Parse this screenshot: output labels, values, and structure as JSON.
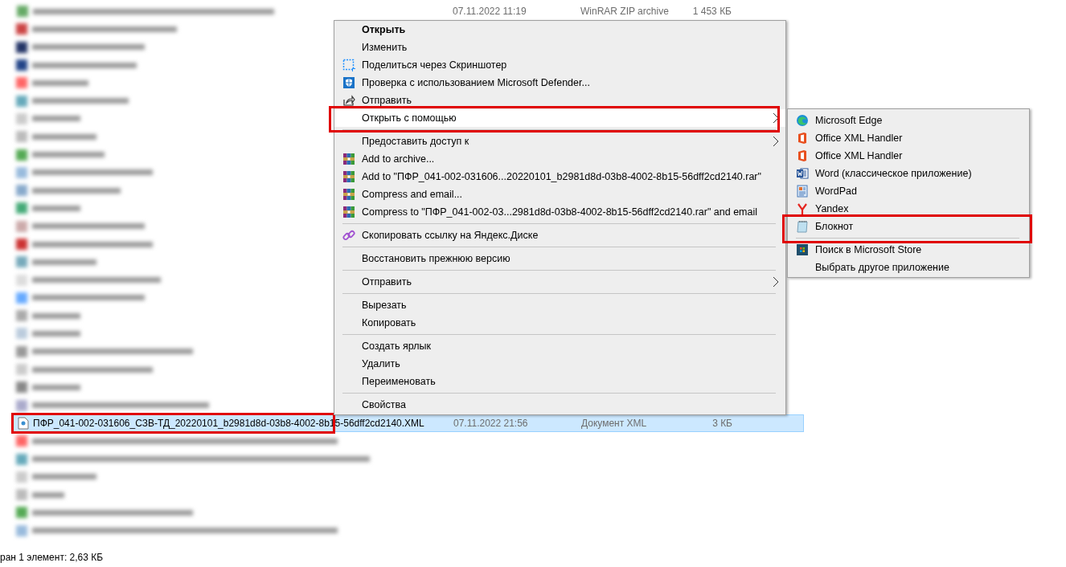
{
  "files_top": [
    {
      "date": "07.11.2022 11:19",
      "type": "WinRAR ZIP archive",
      "size": "1 453 КБ"
    }
  ],
  "selected_file": {
    "name": "ПФР_041-002-031606_СЗВ-ТД_20220101_b2981d8d-03b8-4002-8b15-56dff2cd2140.XML",
    "date": "07.11.2022 21:56",
    "type": "Документ XML",
    "size": "3 КБ",
    "selected": true,
    "highlighted": true
  },
  "context_menu": [
    {
      "kind": "item",
      "label": "Открыть",
      "default": true
    },
    {
      "kind": "item",
      "label": "Изменить"
    },
    {
      "kind": "item",
      "label": "Поделиться через Скриншотер"
    },
    {
      "kind": "item",
      "label": "Проверка с использованием Microsoft Defender..."
    },
    {
      "kind": "item",
      "label": "Отправить"
    },
    {
      "kind": "item",
      "label": "Открыть с помощью",
      "submenu": true,
      "selected": true,
      "highlighted": true
    },
    {
      "kind": "separator"
    },
    {
      "kind": "item",
      "label": "Предоставить доступ к",
      "submenu": true,
      "selected": false
    },
    {
      "kind": "item",
      "label": "Add to archive..."
    },
    {
      "kind": "item",
      "label": "Add to \"ПФР_041-002-031606...20220101_b2981d8d-03b8-4002-8b15-56dff2cd2140.rar\""
    },
    {
      "kind": "item",
      "label": "Compress and email..."
    },
    {
      "kind": "item",
      "label": "Compress to \"ПФР_041-002-03...2981d8d-03b8-4002-8b15-56dff2cd2140.rar\" and email"
    },
    {
      "kind": "separator"
    },
    {
      "kind": "item",
      "label": "Скопировать ссылку на Яндекс.Диске"
    },
    {
      "kind": "separator"
    },
    {
      "kind": "item",
      "label": "Восстановить прежнюю версию"
    },
    {
      "kind": "separator"
    },
    {
      "kind": "item",
      "label": "Отправить",
      "submenu": true,
      "selected": false
    },
    {
      "kind": "separator"
    },
    {
      "kind": "item",
      "label": "Вырезать"
    },
    {
      "kind": "item",
      "label": "Копировать"
    },
    {
      "kind": "separator"
    },
    {
      "kind": "item",
      "label": "Создать ярлык"
    },
    {
      "kind": "item",
      "label": "Удалить"
    },
    {
      "kind": "item",
      "label": "Переименовать"
    },
    {
      "kind": "separator"
    },
    {
      "kind": "item",
      "label": "Свойства"
    }
  ],
  "open_with_submenu": [
    {
      "kind": "item",
      "label": "Microsoft Edge"
    },
    {
      "kind": "item",
      "label": "Office XML Handler"
    },
    {
      "kind": "item",
      "label": "Office XML Handler"
    },
    {
      "kind": "item",
      "label": "Word (классическое приложение)"
    },
    {
      "kind": "item",
      "label": "WordPad"
    },
    {
      "kind": "item",
      "label": "Yandex"
    },
    {
      "kind": "item",
      "label": "Блокнот",
      "highlighted": true
    },
    {
      "kind": "separator"
    },
    {
      "kind": "item",
      "label": "Поиск в Microsoft Store"
    },
    {
      "kind": "item",
      "label": "Выбрать другое приложение"
    }
  ],
  "status_bar": {
    "text": "ран 1 элемент: 2,63 КБ"
  }
}
